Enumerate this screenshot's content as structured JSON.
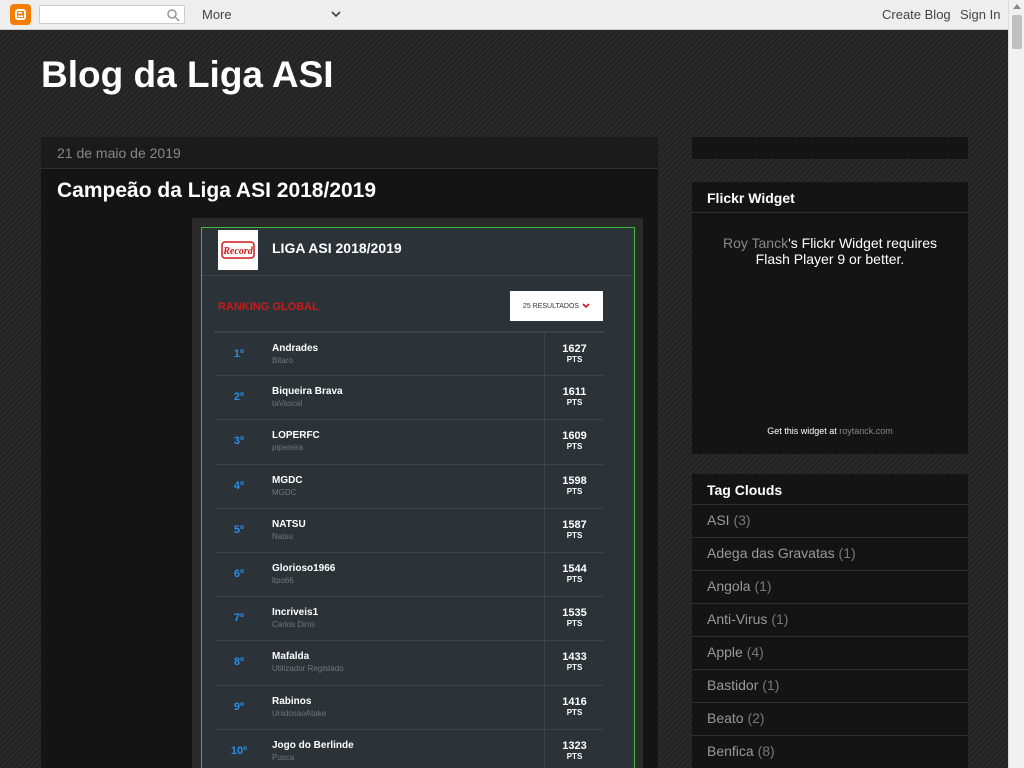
{
  "navbar": {
    "more_label": "More",
    "create_blog": "Create Blog",
    "sign_in": "Sign In",
    "search_placeholder": ""
  },
  "blog": {
    "title": "Blog da Liga ASI"
  },
  "post": {
    "date": "21 de maio de 2019",
    "title": "Campeão da Liga ASI 2018/2019"
  },
  "ranking": {
    "logo_text": "Record",
    "card_title": "LIGA ASI 2018/2019",
    "section_label": "RANKING GLOBAL",
    "results_select": "25 RESULTADOS",
    "pts_label": "PTS",
    "rows": [
      {
        "rank": "1º",
        "team": "Andrades",
        "owner": "Bitaro",
        "pts": "1627"
      },
      {
        "rank": "2º",
        "team": "Biqueira Brava",
        "owner": "taVascal",
        "pts": "1611"
      },
      {
        "rank": "3º",
        "team": "LOPERFC",
        "owner": "pipereira",
        "pts": "1609"
      },
      {
        "rank": "4º",
        "team": "MGDC",
        "owner": "MGDC",
        "pts": "1598"
      },
      {
        "rank": "5º",
        "team": "NATSU",
        "owner": "Natsu",
        "pts": "1587"
      },
      {
        "rank": "6º",
        "team": "Glorioso1966",
        "owner": "ltpo66",
        "pts": "1544"
      },
      {
        "rank": "7º",
        "team": "Incriveis1",
        "owner": "Carlos Dinis",
        "pts": "1535"
      },
      {
        "rank": "8º",
        "team": "Mafalda",
        "owner": "Utilizador Registado",
        "pts": "1433"
      },
      {
        "rank": "9º",
        "team": "Rabinos",
        "owner": "UnidosaoAtake",
        "pts": "1416"
      },
      {
        "rank": "10º",
        "team": "Jogo do Berlinde",
        "owner": "Pusca",
        "pts": "1323"
      }
    ]
  },
  "sidebar": {
    "flickr": {
      "title": "Flickr Widget",
      "link_text": "Roy Tanck",
      "body_text": "'s Flickr Widget requires Flash Player 9 or better.",
      "footer_text": "Get this widget at ",
      "footer_link": "roytanck.com"
    },
    "tags": {
      "title": "Tag Clouds",
      "items": [
        {
          "name": "ASI",
          "count": "(3)"
        },
        {
          "name": "Adega das Gravatas",
          "count": "(1)"
        },
        {
          "name": "Angola",
          "count": "(1)"
        },
        {
          "name": "Anti-Virus",
          "count": "(1)"
        },
        {
          "name": "Apple",
          "count": "(4)"
        },
        {
          "name": "Bastidor",
          "count": "(1)"
        },
        {
          "name": "Beato",
          "count": "(2)"
        },
        {
          "name": "Benfica",
          "count": "(8)"
        }
      ]
    }
  },
  "colors": {
    "rank_blue": "#2a8ee6",
    "ranking_red": "#d01818",
    "card_border_green": "#3bbd3b",
    "blogger_orange": "#f57d00"
  }
}
